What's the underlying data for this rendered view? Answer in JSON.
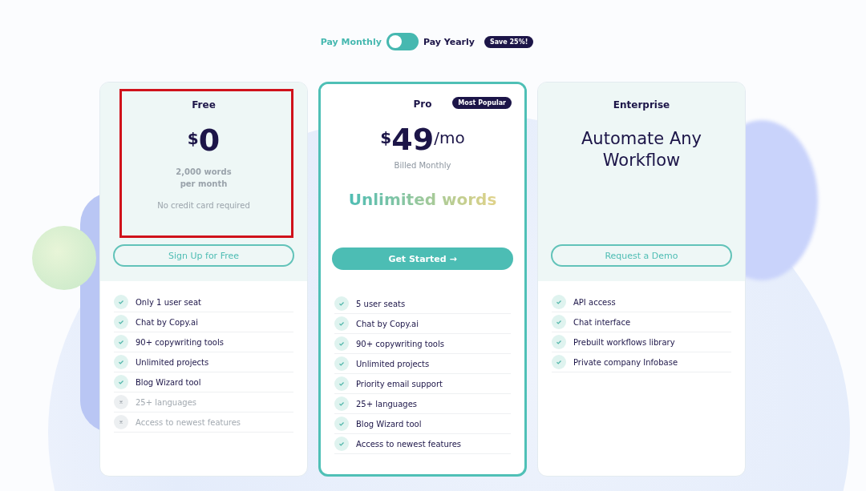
{
  "billing": {
    "monthly_label": "Pay Monthly",
    "yearly_label": "Pay Yearly",
    "yearly": false,
    "badge": "Save 25%!"
  },
  "plans": [
    {
      "kind": "price",
      "name": "Free",
      "highlighted": false,
      "currency": "$",
      "amount": "0",
      "lines": [
        "2,000 words",
        "per month"
      ],
      "note": "No credit card required",
      "button": {
        "kind": "outline",
        "label": "Sign Up for Free"
      },
      "features": [
        {
          "label": "Only 1 user seat",
          "included": true
        },
        {
          "label": "Chat by Copy.ai",
          "included": true
        },
        {
          "label": "90+ copywriting tools",
          "included": true
        },
        {
          "label": "Unlimited projects",
          "included": true
        },
        {
          "label": "Blog Wizard tool",
          "included": true
        },
        {
          "label": "25+ languages",
          "included": false
        },
        {
          "label": "Access to newest features",
          "included": false
        }
      ]
    },
    {
      "kind": "price",
      "name": "Pro",
      "highlighted": true,
      "badge": "Most Popular",
      "currency": "$",
      "amount": "49",
      "period": "/mo",
      "billed": "Billed Monthly",
      "tagline": "Unlimited words",
      "button": {
        "kind": "filled",
        "label": "Get Started",
        "arrow": "→"
      },
      "features": [
        {
          "label": "5 user seats",
          "included": true
        },
        {
          "label": "Chat by Copy.ai",
          "included": true
        },
        {
          "label": "90+ copywriting tools",
          "included": true
        },
        {
          "label": "Unlimited projects",
          "included": true
        },
        {
          "label": "Priority email support",
          "included": true
        },
        {
          "label": "25+ languages",
          "included": true
        },
        {
          "label": "Blog Wizard tool",
          "included": true
        },
        {
          "label": "Access to newest features",
          "included": true
        }
      ]
    },
    {
      "kind": "headline",
      "name": "Enterprise",
      "highlighted": false,
      "headline": "Automate Any Workflow",
      "button": {
        "kind": "outline",
        "label": "Request a Demo"
      },
      "features": [
        {
          "label": "API access",
          "included": true
        },
        {
          "label": "Chat interface",
          "included": true
        },
        {
          "label": "Prebuilt workflows library",
          "included": true
        },
        {
          "label": "Private company Infobase",
          "included": true
        }
      ]
    }
  ]
}
